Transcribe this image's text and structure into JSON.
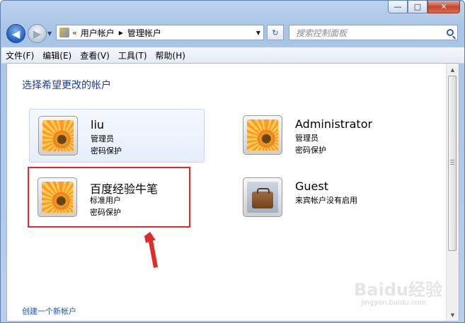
{
  "window": {
    "caption_buttons": {
      "minimize": "—",
      "maximize": "□",
      "close": "✕"
    }
  },
  "navigation": {
    "back_icon": "◀",
    "forward_icon": "▶",
    "address": {
      "chevron": "«",
      "segments": [
        "用户帐户",
        "管理帐户"
      ],
      "separator": "▶"
    },
    "refresh_icon": "↻",
    "search": {
      "placeholder": "搜索控制面板"
    }
  },
  "menubar": {
    "items": [
      "文件(F)",
      "编辑(E)",
      "查看(V)",
      "工具(T)",
      "帮助(H)"
    ]
  },
  "content": {
    "title": "选择希望更改的帐户",
    "accounts": [
      {
        "name": "liu",
        "type": "管理员",
        "status": "密码保护",
        "picture": "flower-icon"
      },
      {
        "name": "Administrator",
        "type": "管理员",
        "status": "密码保护",
        "picture": "flower-icon"
      },
      {
        "name": "百度经验牛笔",
        "type": "标准用户",
        "status": "密码保护",
        "picture": "flower-icon"
      },
      {
        "name": "Guest",
        "type": "来宾帐户没有启用",
        "status": "",
        "picture": "suitcase-icon"
      }
    ],
    "create_link": "创建一个新帐户"
  },
  "watermark": {
    "logo": "Baidu经验",
    "url": "jingyan.baidu.com"
  },
  "colors": {
    "title": "#1e3f87",
    "link": "#1e56b0",
    "highlight": "#e02b2b"
  }
}
